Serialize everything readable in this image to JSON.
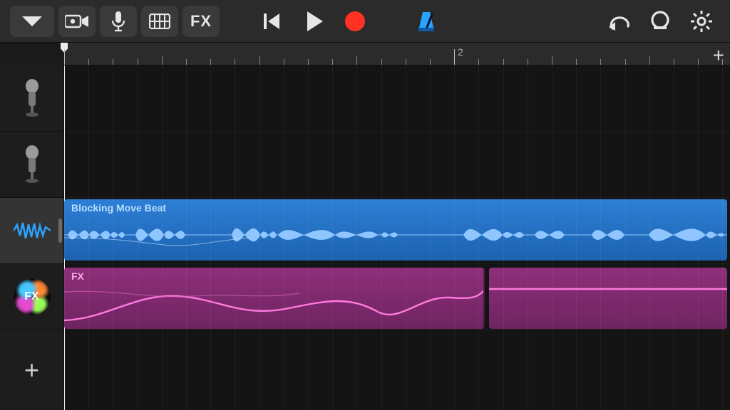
{
  "toolbar": {
    "fx_label": "FX"
  },
  "ruler": {
    "marker_2_label": "2"
  },
  "tracks": [
    {
      "icon": "microphone",
      "selected": false
    },
    {
      "icon": "microphone",
      "selected": false
    },
    {
      "icon": "waveform",
      "selected": true
    },
    {
      "icon": "fx",
      "selected": false
    }
  ],
  "regions": {
    "audio_name": "Blocking Move Beat",
    "fx_name": "FX"
  },
  "fx_badge_label": "FX",
  "colors": {
    "accent_blue": "#2d7fd6",
    "accent_purple": "#8f2f7b",
    "record_red": "#ff3224",
    "metronome_blue": "#2aa3ff"
  }
}
